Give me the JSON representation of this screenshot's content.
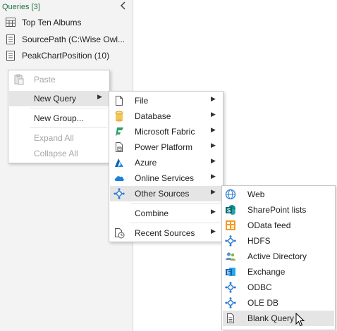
{
  "queries_pane": {
    "title": "Queries [3]",
    "collapse_icon": "chevron-left-icon",
    "items": [
      {
        "label": "Top Ten Albums",
        "icon": "table-icon"
      },
      {
        "label": "SourcePath (C:\\Wise Owl...",
        "icon": "parameter-icon"
      },
      {
        "label": "PeakChartPosition (10)",
        "icon": "parameter-icon"
      }
    ]
  },
  "context_menu": {
    "items": [
      {
        "label": "Paste",
        "enabled": false,
        "icon": "paste-icon"
      },
      {
        "label": "New Query",
        "enabled": true,
        "submenu": true
      },
      {
        "label": "New Group...",
        "enabled": true
      },
      {
        "label": "Expand All",
        "enabled": false
      },
      {
        "label": "Collapse All",
        "enabled": false
      }
    ]
  },
  "new_query_menu": {
    "items": [
      {
        "label": "File",
        "icon": "file-icon"
      },
      {
        "label": "Database",
        "icon": "database-icon"
      },
      {
        "label": "Microsoft Fabric",
        "icon": "fabric-icon"
      },
      {
        "label": "Power Platform",
        "icon": "power-platform-icon"
      },
      {
        "label": "Azure",
        "icon": "azure-icon"
      },
      {
        "label": "Online Services",
        "icon": "cloud-icon"
      },
      {
        "label": "Other Sources",
        "icon": "other-sources-icon"
      },
      {
        "label": "Combine",
        "icon": ""
      },
      {
        "label": "Recent Sources",
        "icon": "recent-sources-icon"
      }
    ]
  },
  "other_sources_menu": {
    "items": [
      {
        "label": "Web",
        "icon": "globe-icon"
      },
      {
        "label": "SharePoint lists",
        "icon": "sharepoint-icon"
      },
      {
        "label": "OData feed",
        "icon": "odata-icon"
      },
      {
        "label": "HDFS",
        "icon": "connector-icon"
      },
      {
        "label": "Active Directory",
        "icon": "users-icon"
      },
      {
        "label": "Exchange",
        "icon": "exchange-icon"
      },
      {
        "label": "ODBC",
        "icon": "connector-icon"
      },
      {
        "label": "OLE DB",
        "icon": "connector-icon"
      },
      {
        "label": "Blank Query",
        "icon": "blank-query-icon"
      }
    ]
  },
  "colors": {
    "accent_green": "#217346",
    "highlight": "#e5e5e5",
    "connector_blue": "#2b7cd3"
  }
}
